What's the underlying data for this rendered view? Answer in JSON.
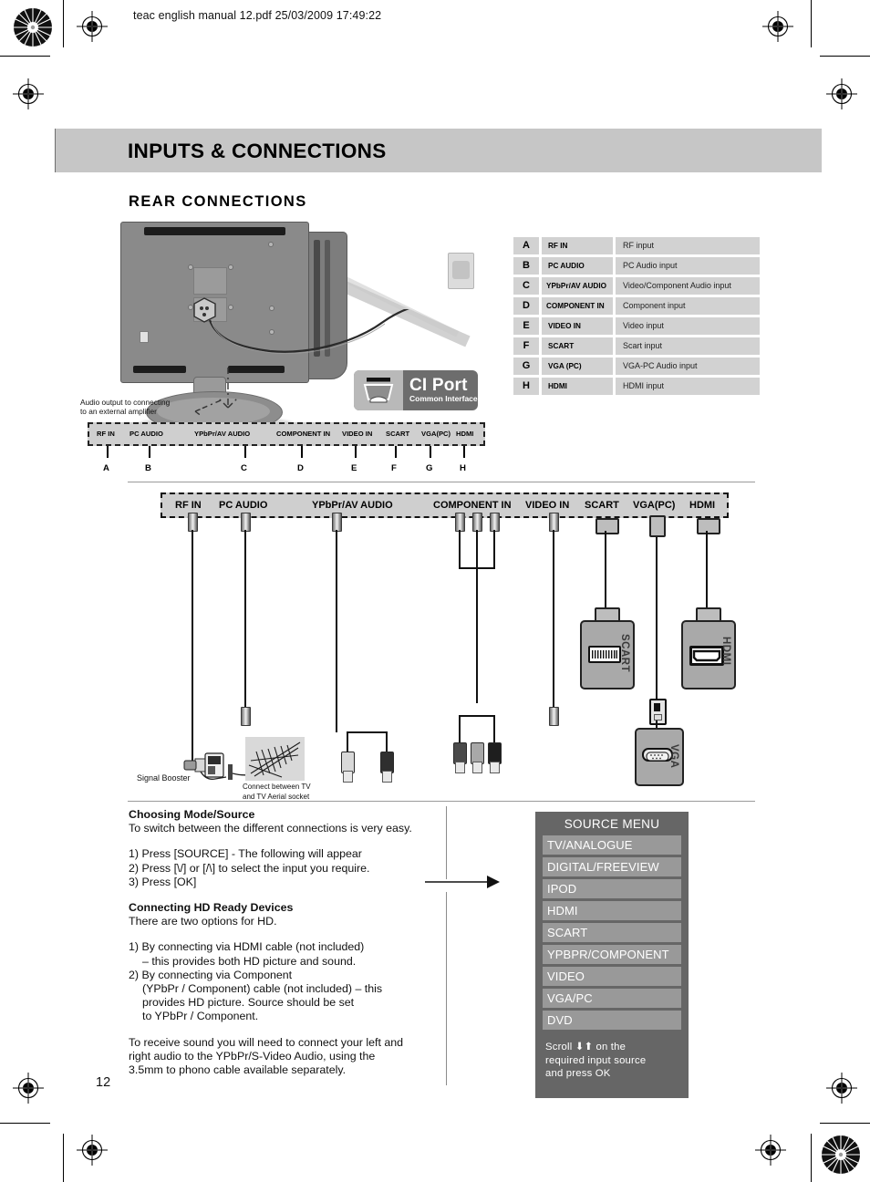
{
  "print_header": "teac english manual 12.pdf   25/03/2009   17:49:22",
  "chapter_title": "INPUTS & CONNECTIONS",
  "section_title": "REAR CONNECTIONS",
  "page_number": "12",
  "illustration": {
    "ci_port_name": "CI Port",
    "ci_port_sub": "Common Interface",
    "audio_note_line1": "Audio output to connecting",
    "audio_note_line2": "to an external amplifier",
    "signal_booster_label": "Signal Booster",
    "aerial_caption_line1": "Connect between TV",
    "aerial_caption_line2": "and TV Aerial socket",
    "scart_box_label": "SCART",
    "hdmi_box_label": "HDMI",
    "vga_box_label": "VGA"
  },
  "panel_small": {
    "labels": [
      "RF IN",
      "PC AUDIO",
      "YPbPr/AV AUDIO",
      "COMPONENT IN",
      "VIDEO IN",
      "SCART",
      "VGA(PC)",
      "HDMI"
    ],
    "letters": [
      "A",
      "B",
      "C",
      "D",
      "E",
      "F",
      "G",
      "H"
    ]
  },
  "panel_big": {
    "labels": [
      "RF IN",
      "PC AUDIO",
      "YPbPr/AV AUDIO",
      "COMPONENT IN",
      "VIDEO IN",
      "SCART",
      "VGA(PC)",
      "HDMI"
    ]
  },
  "connection_table": {
    "rows": [
      {
        "letter": "A",
        "name": "RF IN",
        "description": "RF input"
      },
      {
        "letter": "B",
        "name": "PC AUDIO",
        "description": "PC Audio input"
      },
      {
        "letter": "C",
        "name": "YPbPr/AV AUDIO",
        "description": "Video/Component Audio input"
      },
      {
        "letter": "D",
        "name": "COMPONENT IN",
        "description": "Component input"
      },
      {
        "letter": "E",
        "name": "VIDEO IN",
        "description": "Video input"
      },
      {
        "letter": "F",
        "name": "SCART",
        "description": "Scart input"
      },
      {
        "letter": "G",
        "name": "VGA (PC)",
        "description": "VGA-PC Audio input"
      },
      {
        "letter": "H",
        "name": "HDMI",
        "description": "HDMI input"
      }
    ]
  },
  "instructions": {
    "heading1": "Choosing Mode/Source",
    "intro1": "To switch between the different connections is very easy.",
    "step1": "1) Press [SOURCE] - The following will appear",
    "step2": "2) Press [\\/] or [/\\] to select the input you require.",
    "step3": "3) Press [OK]",
    "heading2": "Connecting HD Ready Devices",
    "intro2": "There are two options for HD.",
    "hd1_line1": "1) By connecting via HDMI cable (not included)",
    "hd1_line2": "– this provides both HD picture and sound.",
    "hd2_line1": "2) By connecting via Component",
    "hd2_line2": "(YPbPr / Component) cable (not included) – this",
    "hd2_line3": "provides HD picture. Source should be set",
    "hd2_line4": "to YPbPr / Component.",
    "sound_line1": "To receive sound you will need to connect your left and",
    "sound_line2": "right audio to the YPbPr/S-Video Audio, using the",
    "sound_line3": "3.5mm to phono cable available separately."
  },
  "source_menu": {
    "title": "SOURCE MENU",
    "items": [
      "TV/ANALOGUE",
      "DIGITAL/FREEVIEW",
      "IPOD",
      "HDMI",
      "SCART",
      "YPBPR/COMPONENT",
      "VIDEO",
      "VGA/PC",
      "DVD"
    ],
    "footer_line1": "Scroll  ⬇⬆   on the",
    "footer_line2": "required input source",
    "footer_line3": "and press OK"
  },
  "colors": {
    "band": "#c6c6c6",
    "panel": "#cfcfcf",
    "menu_bg": "#666666",
    "menu_item": "#999999",
    "table_cell": "#d2d2d2"
  }
}
